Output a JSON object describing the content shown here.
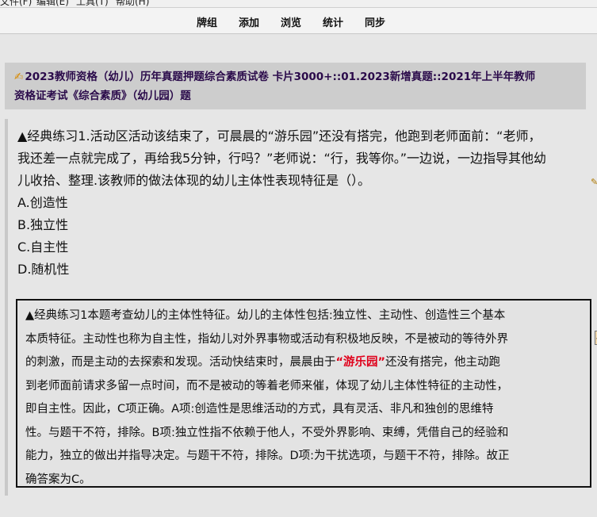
{
  "menu": {
    "items": [
      "文件(F)",
      "编辑(E)",
      "工具(T)",
      "帮助(H)"
    ]
  },
  "toolbar": {
    "buttons": [
      "牌组",
      "添加",
      "浏览",
      "统计",
      "同步"
    ]
  },
  "deck": {
    "icon": "pencil-hand-icon",
    "line1": "2023教师资格（幼儿）历年真题押题综合素质试卷 卡片3000+::01.2023新增真题::2021年上半年教师",
    "line2": "资格证考试《综合素质》（幼儿园）题"
  },
  "question": {
    "lines": [
      "▲经典练习1.活动区活动该结束了，可晨晨的“游乐园”还没有搭完，他跑到老师面前：“老师，",
      "我还差一点就完成了，再给我5分钟，行吗？”老师说：“行，我等你。”一边说，一边指导其他幼",
      "儿收拾、整理.该教师的做法体现的幼儿主体性表现特征是（）。"
    ],
    "options": [
      "A.创造性",
      "B.独立性",
      "C.自主性",
      "D.随机性"
    ]
  },
  "answer": {
    "lines": [
      "▲经典练习1本题考查幼儿的主体性特征。幼儿的主体性包括:独立性、主动性、创造性三个基本",
      "本质特征。主动性也称为自主性，指幼儿对外界事物或活动有积极地反映，不是被动的等待外界",
      "的刺激，而是主动的去探索和发现。活动快结束时，晨晨由于",
      "到老师面前请求多留一点时间，而不是被动的等着老师来催，体现了幼儿主体性特征的主动性，",
      "即自主性。因此，C项正确。A项:创造性是思维活动的方式，具有灵活、非凡和独创的思维特",
      "性。与题干不符，排除。B项:独立性指不依赖于他人，不受外界影响、束缚，凭借自己的经验和",
      "能力，独立的做出并指导决定。与题干不符，排除。D项:为干扰选项，与题干不符，排除。故正",
      "确答案为C。"
    ],
    "highlight": "“游乐园”",
    "line3_tail": "还没有搭完，他主动跑",
    "highlight_color": "#e0001b"
  }
}
